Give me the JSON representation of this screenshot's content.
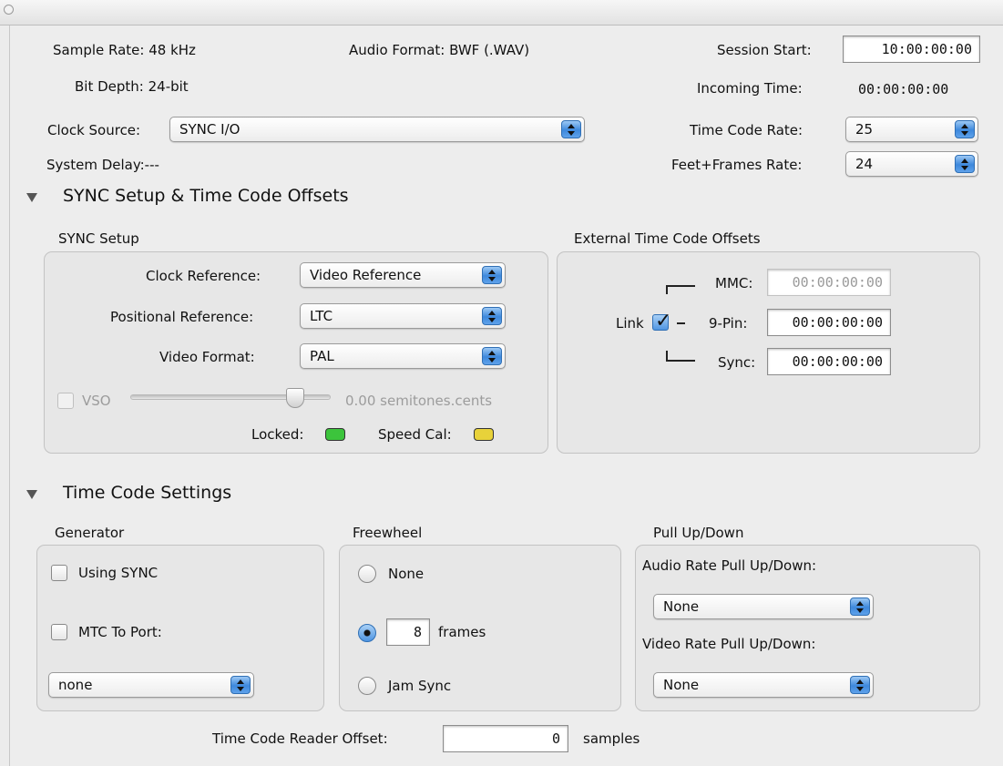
{
  "header": {
    "sample_rate": "Sample Rate: 48 kHz",
    "audio_format": "Audio Format: BWF (.WAV)",
    "session_start_label": "Session Start:",
    "session_start_value": "10:00:00:00",
    "bit_depth": "Bit Depth: 24-bit",
    "incoming_time_label": "Incoming Time:",
    "incoming_time_value": "00:00:00:00",
    "clock_source_label": "Clock Source:",
    "clock_source_value": "SYNC I/O",
    "time_code_rate_label": "Time Code Rate:",
    "time_code_rate_value": "25",
    "system_delay": "System Delay:---",
    "feet_frames_rate_label": "Feet+Frames Rate:",
    "feet_frames_rate_value": "24"
  },
  "sync_section": {
    "title": "SYNC Setup & Time Code Offsets",
    "sync_setup": {
      "title": "SYNC Setup",
      "clock_reference_label": "Clock Reference:",
      "clock_reference_value": "Video Reference",
      "positional_reference_label": "Positional Reference:",
      "positional_reference_value": "LTC",
      "video_format_label": "Video Format:",
      "video_format_value": "PAL",
      "vso_label": "VSO",
      "vso_value": "0.00 semitones.cents",
      "locked_label": "Locked:",
      "speed_cal_label": "Speed Cal:",
      "locked_color": "#3cc43c",
      "speed_cal_color": "#e8d23a"
    },
    "offsets": {
      "title": "External Time Code Offsets",
      "mmc_label": "MMC:",
      "mmc_value": "00:00:00:00",
      "link_label": "Link",
      "nine_pin_label": "9-Pin:",
      "nine_pin_value": "00:00:00:00",
      "sync_label": "Sync:",
      "sync_value": "00:00:00:00"
    }
  },
  "tc_section": {
    "title": "Time Code Settings",
    "generator": {
      "title": "Generator",
      "using_sync_label": "Using SYNC",
      "mtc_to_port_label": "MTC To Port:",
      "port_value": "none"
    },
    "freewheel": {
      "title": "Freewheel",
      "none_label": "None",
      "frames_value": "8",
      "frames_label": "frames",
      "jam_sync_label": "Jam Sync"
    },
    "pull": {
      "title": "Pull Up/Down",
      "audio_label": "Audio Rate Pull Up/Down:",
      "audio_value": "None",
      "video_label": "Video Rate Pull Up/Down:",
      "video_value": "None"
    }
  },
  "footer": {
    "reader_offset_label": "Time Code Reader Offset:",
    "reader_offset_value": "0",
    "samples_label": "samples"
  }
}
